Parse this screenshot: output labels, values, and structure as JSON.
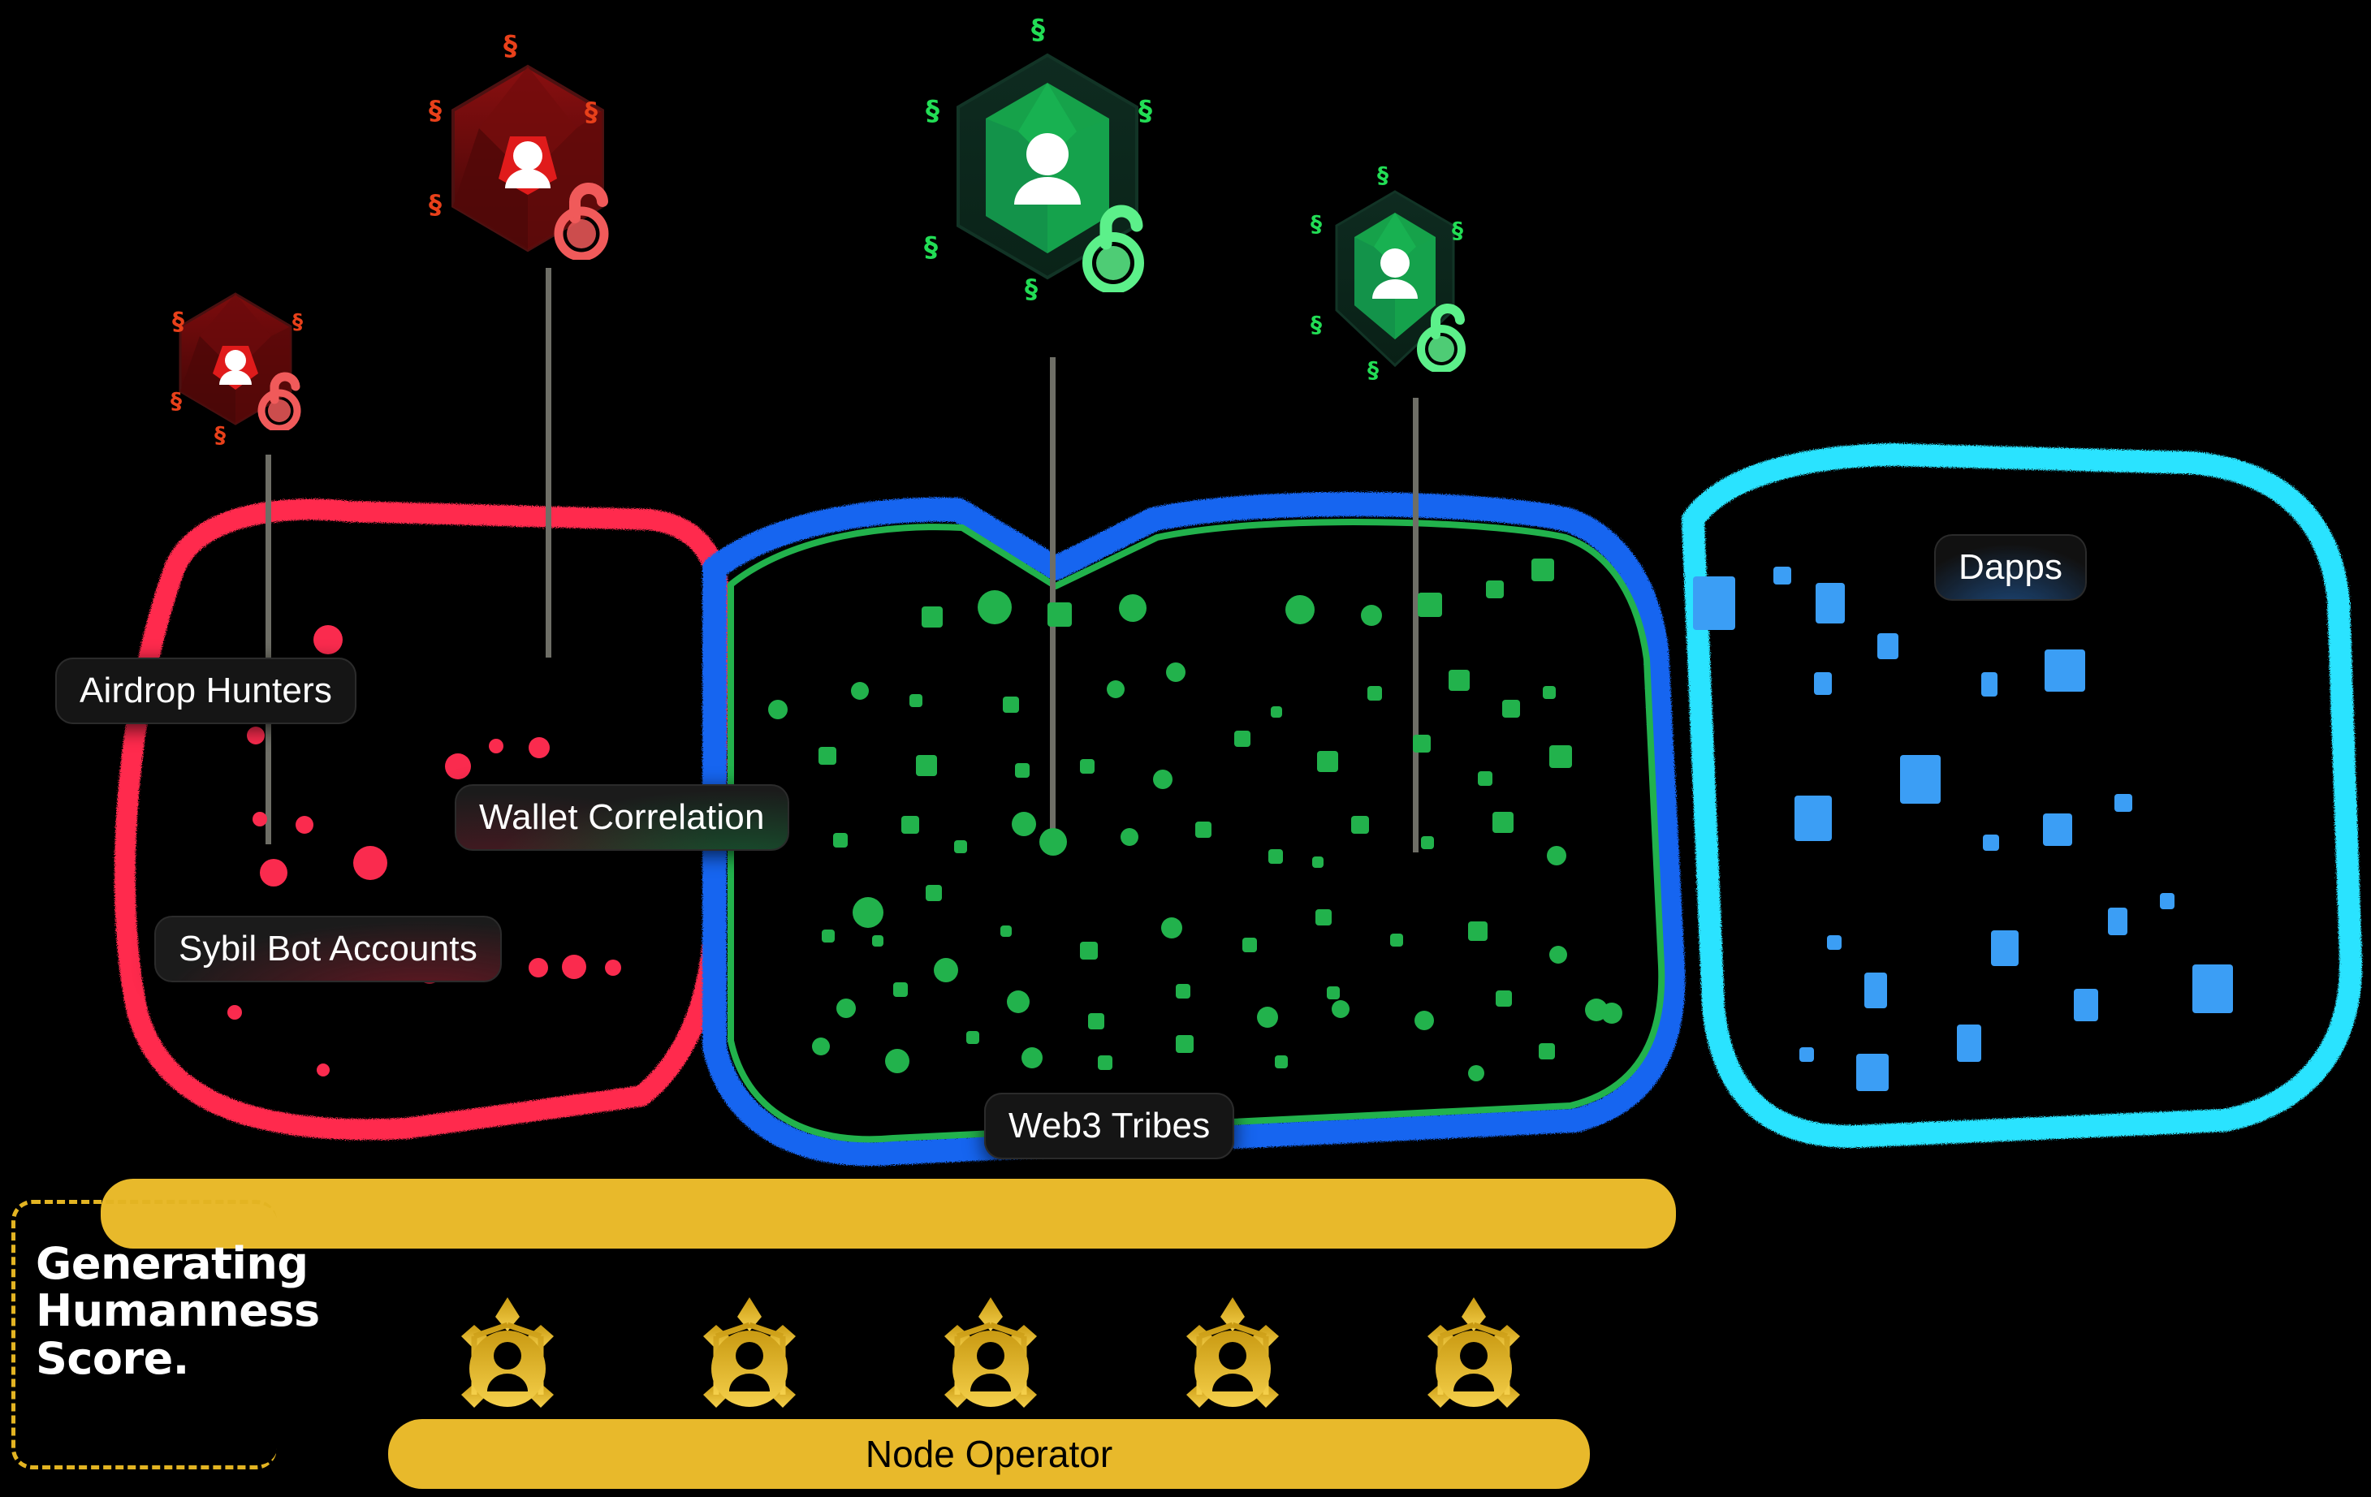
{
  "diagram": {
    "title_overlay": "Generating Humanness Score.",
    "background_color": "#000000"
  },
  "clusters": [
    {
      "id": "airdrop",
      "label": "Airdrop Hunters",
      "color": "#FA2B4E",
      "outline": "#FF2B4E"
    },
    {
      "id": "sybil",
      "label": "Sybil Bot Accounts",
      "color": "#FA2B4E",
      "outline": "#FF2B4E"
    },
    {
      "id": "wallet",
      "label": "Wallet Correlation",
      "color": "#9B1F3A",
      "outline": "#1F6BE0"
    },
    {
      "id": "web3",
      "label": "Web3 Tribes",
      "color": "#22B24C",
      "outline": "#1565F0"
    },
    {
      "id": "dapps",
      "label": "Dapps",
      "color": "#3B9EF5",
      "outline": "#2BE3FF"
    }
  ],
  "labels": {
    "airdrop_hunters": "Airdrop Hunters",
    "sybil_bot_accounts": "Sybil Bot Accounts",
    "wallet_correlation": "Wallet Correlation",
    "web3_tribes": "Web3 Tribes",
    "dapps": "Dapps",
    "node_operator": "Node Operator"
  },
  "callout": {
    "line1": "Generating",
    "line2": "Humanness",
    "line3": "Score.",
    "border_color": "#E3B422"
  },
  "node_operator": {
    "label": "Node Operator",
    "bar_color": "#E8B92B",
    "node_count": 5,
    "icon_name": "node-operator-icon"
  },
  "avatars": [
    {
      "id": "a1",
      "state": "flagged",
      "gem_color": "#8B0F10",
      "accent": "#E8401A",
      "lock": "unlock-icon",
      "lock_color": "#F05A5A",
      "person": "person-icon",
      "size": "small"
    },
    {
      "id": "a2",
      "state": "flagged",
      "gem_color": "#8B0F10",
      "accent": "#E8401A",
      "lock": "unlock-icon",
      "lock_color": "#F05A5A",
      "person": "person-icon",
      "size": "medium"
    },
    {
      "id": "a3",
      "state": "verified",
      "gem_color": "#18B84A",
      "accent": "#22DD55",
      "lock": "unlock-icon",
      "lock_color": "#5CF08A",
      "person": "person-icon",
      "size": "large"
    },
    {
      "id": "a4",
      "state": "verified",
      "gem_color": "#18B84A",
      "accent": "#22DD55",
      "lock": "unlock-icon",
      "lock_color": "#5CF08A",
      "person": "person-icon",
      "size": "small"
    }
  ],
  "colors": {
    "red": "#FA2B4E",
    "green": "#22B24C",
    "blue": "#3B9EF5",
    "cyan": "#2BE3FF",
    "royal_blue": "#1565F0",
    "gold": "#E8B92B",
    "chip_bg": "#1b1b1b",
    "text": "#FFFFFF"
  }
}
